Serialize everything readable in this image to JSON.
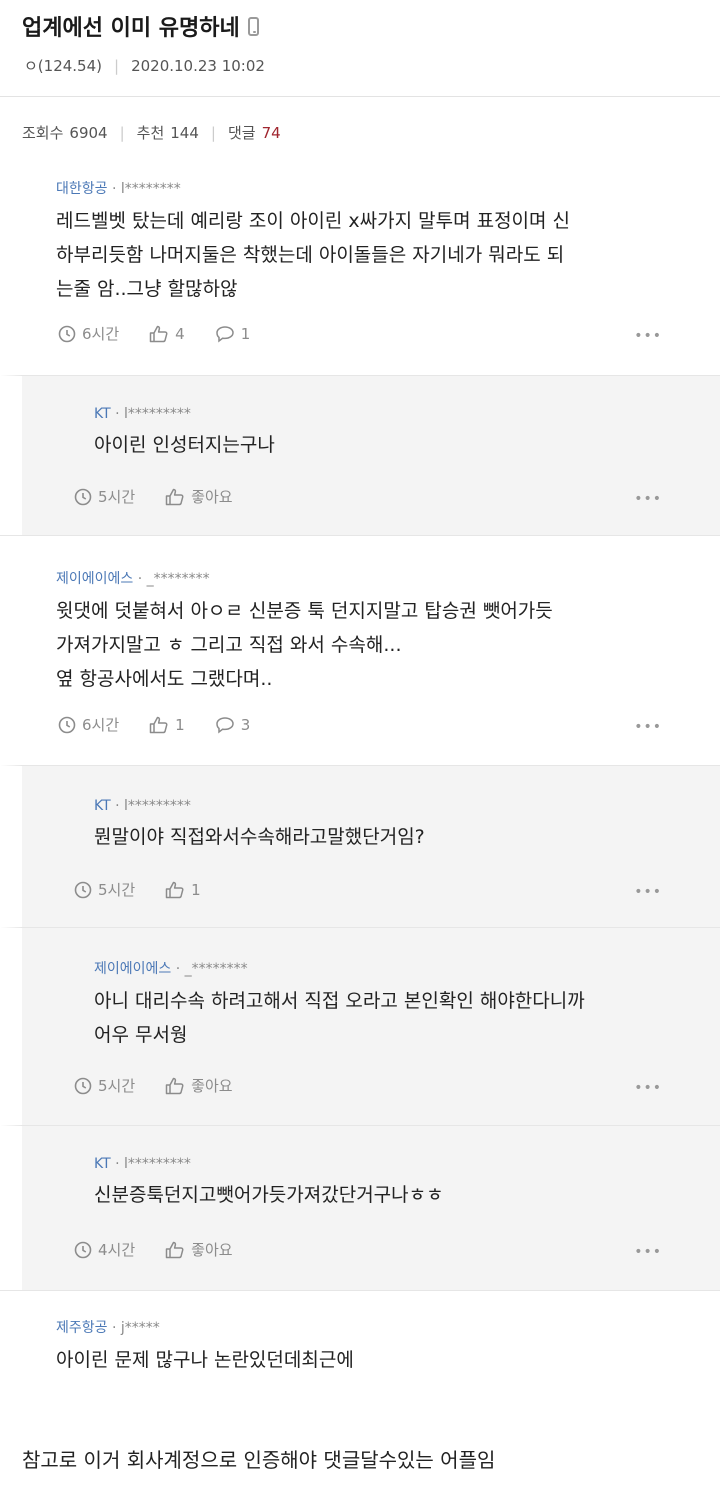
{
  "post": {
    "title": "업계에선 이미 유명하네",
    "author_meta": "ㅇ(124.54)",
    "datetime": "2020.10.23 10:02",
    "views_label": "조회수",
    "views": "6904",
    "recommend_label": "추천",
    "recommend": "144",
    "comments_label": "댓글",
    "comments": "74"
  },
  "comments": [
    {
      "company": "대한항공",
      "masked": " · l********",
      "text": [
        "레드벨벳 탔는데 예리랑 조이 아이린 x싸가지 말투며 표정이며 신",
        "하부리듯함 나머지둘은 착했는데 아이돌들은 자기네가 뭐라도 되",
        "는줄 암..그냥 할많하않"
      ],
      "time": "6시간",
      "likes": "4",
      "replies": "1"
    },
    {
      "company": "KT",
      "masked": " · l*********",
      "text": [
        "아이린 인성터지는구나"
      ],
      "time": "5시간",
      "likes": "좋아요"
    },
    {
      "company": "제이에이에스",
      "masked": " · _********",
      "text": [
        "윗댓에 덧붙혀서 아ㅇㄹ 신분증 툭 던지지말고 탑승권 뺏어가듯",
        "가져가지말고 ㅎ 그리고 직접 와서 수속해...",
        "옆 항공사에서도 그랬다며.."
      ],
      "time": "6시간",
      "likes": "1",
      "replies": "3"
    },
    {
      "company": "KT",
      "masked": " · l*********",
      "text": [
        "뭔말이야 직접와서수속해라고말했단거임?"
      ],
      "time": "5시간",
      "likes": "1"
    },
    {
      "company": "제이에이에스",
      "masked": " · _********",
      "text": [
        "아니 대리수속 하려고해서 직접 오라고 본인확인 해야한다니까",
        "어우 무서웡"
      ],
      "time": "5시간",
      "likes": "좋아요"
    },
    {
      "company": "KT",
      "masked": " · l*********",
      "text": [
        "신분증툭던지고뺏어가듯가져갔단거구나ㅎㅎ"
      ],
      "time": "4시간",
      "likes": "좋아요"
    },
    {
      "company": "제주항공",
      "masked": " · j*****",
      "text": [
        "아이린 문제 많구나 논란있던데최근에"
      ]
    }
  ],
  "footer_text": "참고로 이거 회사계정으로 인증해야 댓글달수있는 어플임",
  "more_glyph": "•••",
  "colors": {
    "author": "#4b78b6",
    "comment_count": "#a0262f",
    "reply_bg": "#f4f4f4"
  }
}
